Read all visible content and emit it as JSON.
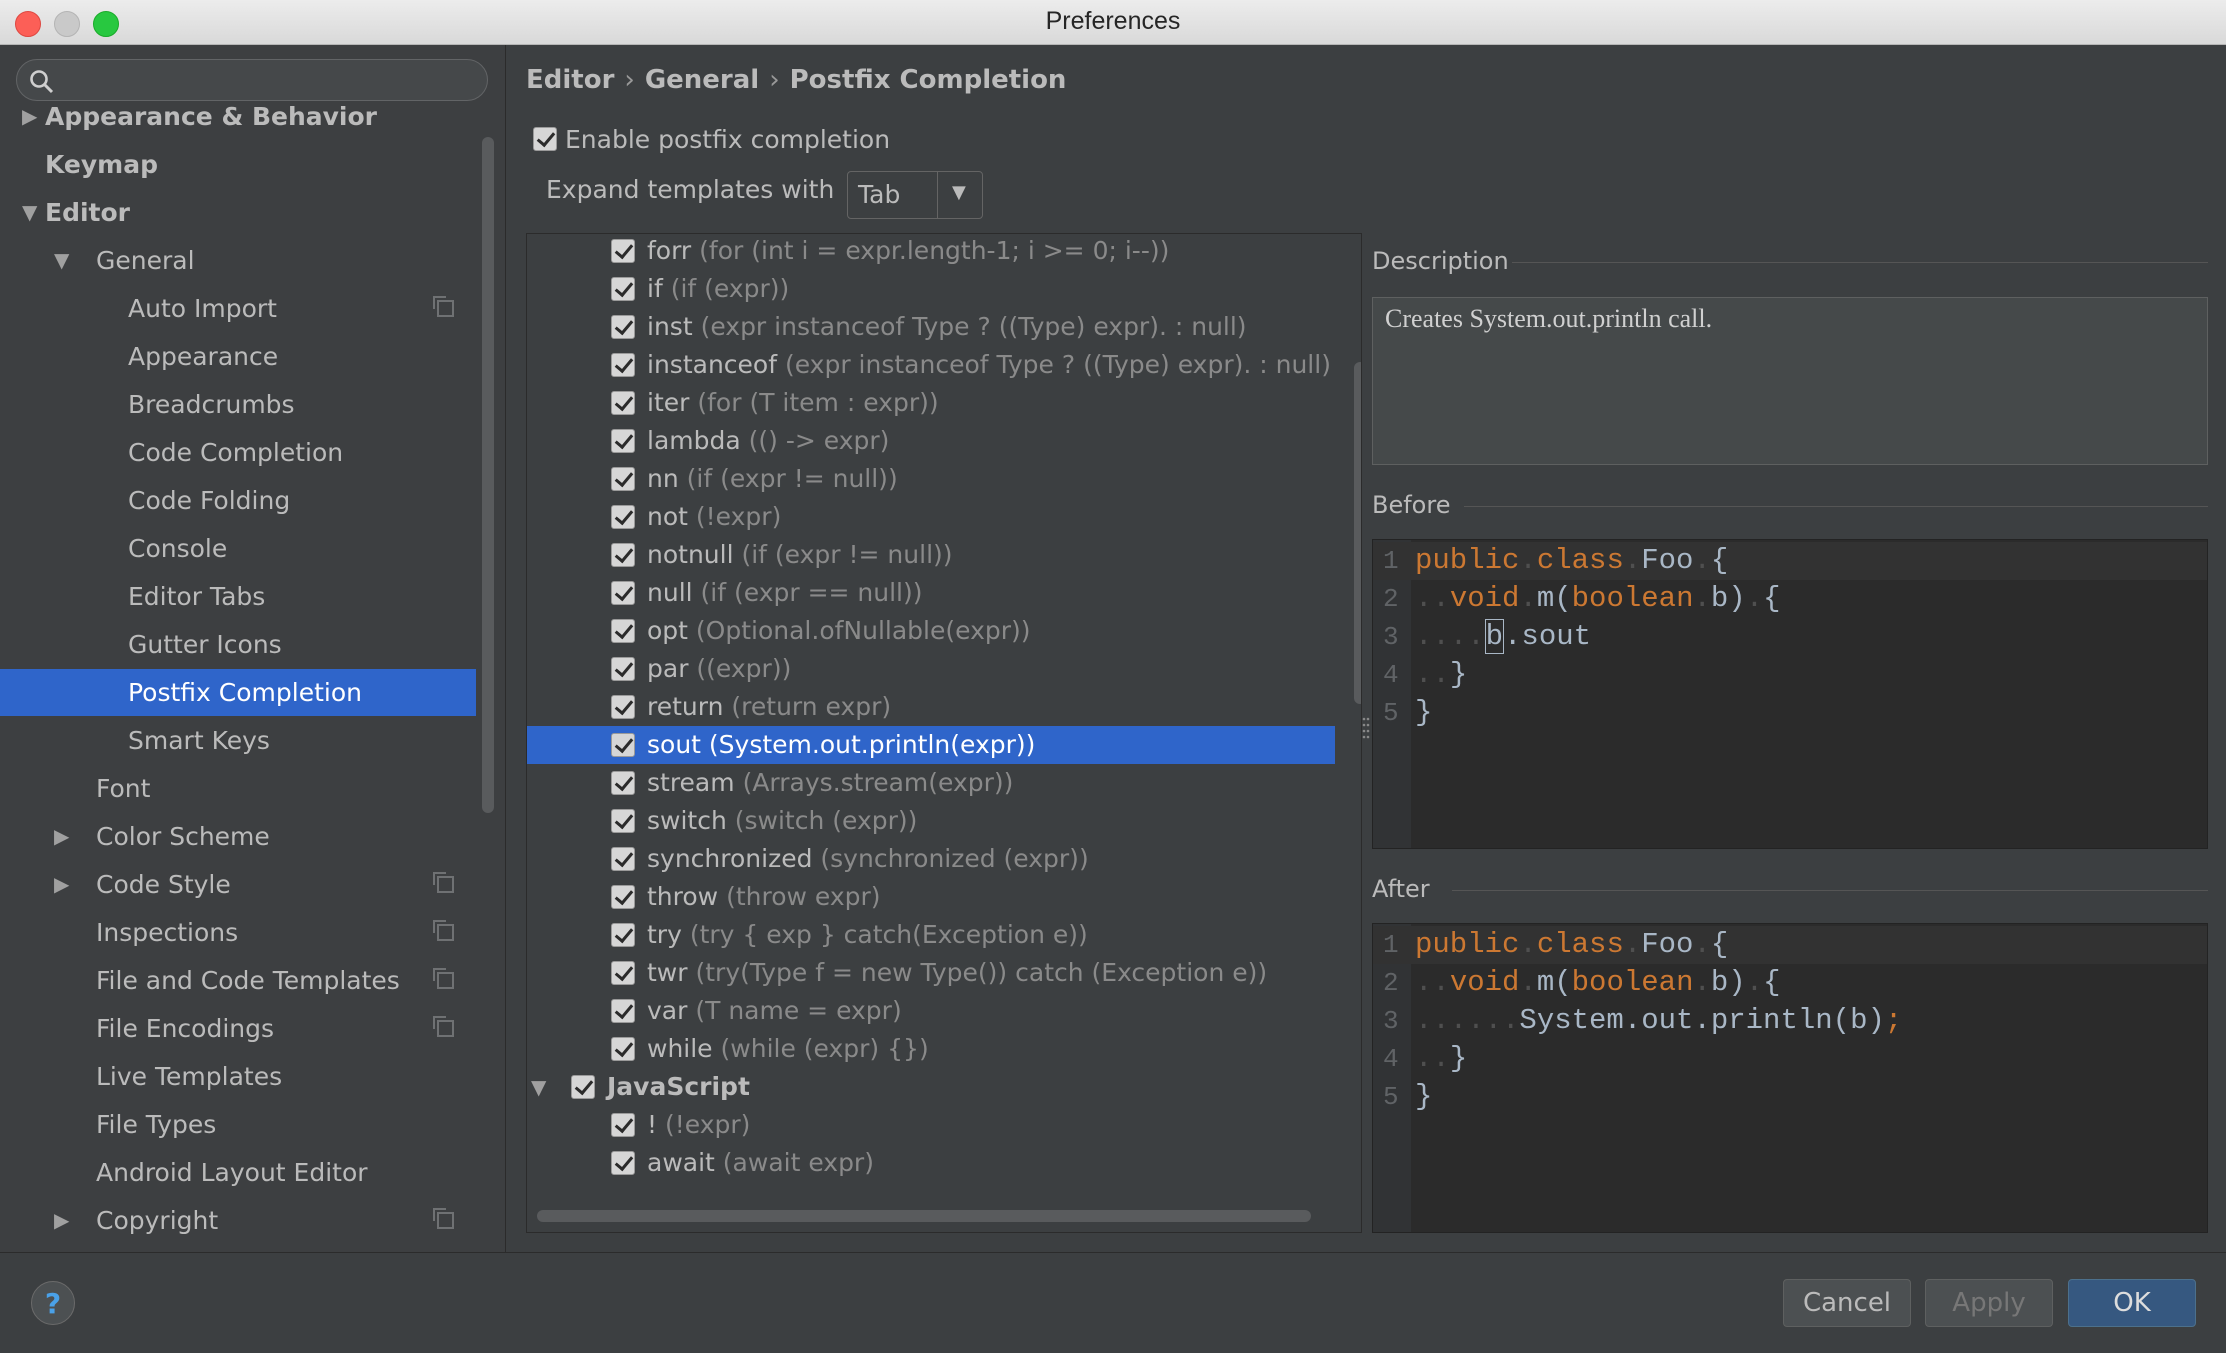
{
  "window": {
    "title": "Preferences"
  },
  "search": {
    "placeholder": "",
    "value": ""
  },
  "sidebar": {
    "items": [
      {
        "label": "Appearance & Behavior",
        "level": 0,
        "arrow": "▶",
        "bold": true,
        "copy": false
      },
      {
        "label": "Keymap",
        "level": 0,
        "arrow": "",
        "bold": true,
        "copy": false
      },
      {
        "label": "Editor",
        "level": 0,
        "arrow": "▼",
        "bold": true,
        "copy": false
      },
      {
        "label": "General",
        "level": 1,
        "arrow": "▼",
        "bold": false,
        "copy": false
      },
      {
        "label": "Auto Import",
        "level": 2,
        "arrow": "",
        "bold": false,
        "copy": true
      },
      {
        "label": "Appearance",
        "level": 2,
        "arrow": "",
        "bold": false,
        "copy": false
      },
      {
        "label": "Breadcrumbs",
        "level": 2,
        "arrow": "",
        "bold": false,
        "copy": false
      },
      {
        "label": "Code Completion",
        "level": 2,
        "arrow": "",
        "bold": false,
        "copy": false
      },
      {
        "label": "Code Folding",
        "level": 2,
        "arrow": "",
        "bold": false,
        "copy": false
      },
      {
        "label": "Console",
        "level": 2,
        "arrow": "",
        "bold": false,
        "copy": false
      },
      {
        "label": "Editor Tabs",
        "level": 2,
        "arrow": "",
        "bold": false,
        "copy": false
      },
      {
        "label": "Gutter Icons",
        "level": 2,
        "arrow": "",
        "bold": false,
        "copy": false
      },
      {
        "label": "Postfix Completion",
        "level": 2,
        "arrow": "",
        "bold": false,
        "copy": false,
        "selected": true
      },
      {
        "label": "Smart Keys",
        "level": 2,
        "arrow": "",
        "bold": false,
        "copy": false
      },
      {
        "label": "Font",
        "level": 1,
        "arrow": "",
        "bold": false,
        "copy": false
      },
      {
        "label": "Color Scheme",
        "level": 1,
        "arrow": "▶",
        "bold": false,
        "copy": false
      },
      {
        "label": "Code Style",
        "level": 1,
        "arrow": "▶",
        "bold": false,
        "copy": true
      },
      {
        "label": "Inspections",
        "level": 1,
        "arrow": "",
        "bold": false,
        "copy": true
      },
      {
        "label": "File and Code Templates",
        "level": 1,
        "arrow": "",
        "bold": false,
        "copy": true
      },
      {
        "label": "File Encodings",
        "level": 1,
        "arrow": "",
        "bold": false,
        "copy": true
      },
      {
        "label": "Live Templates",
        "level": 1,
        "arrow": "",
        "bold": false,
        "copy": false
      },
      {
        "label": "File Types",
        "level": 1,
        "arrow": "",
        "bold": false,
        "copy": false
      },
      {
        "label": "Android Layout Editor",
        "level": 1,
        "arrow": "",
        "bold": false,
        "copy": false
      },
      {
        "label": "Copyright",
        "level": 1,
        "arrow": "▶",
        "bold": false,
        "copy": true
      }
    ]
  },
  "breadcrumb": {
    "parts": [
      "Editor",
      "General",
      "Postfix Completion"
    ],
    "separator": "›"
  },
  "enable": {
    "label": "Enable postfix completion",
    "checked": true
  },
  "expand": {
    "label": "Expand templates with",
    "value": "Tab"
  },
  "templates": [
    {
      "key": "forr",
      "desc": "(for (int i = expr.length-1; i >= 0; i--))",
      "checked": true
    },
    {
      "key": "if",
      "desc": "(if (expr))",
      "checked": true
    },
    {
      "key": "inst",
      "desc": "(expr instanceof Type ? ((Type) expr). : null)",
      "checked": true
    },
    {
      "key": "instanceof",
      "desc": "(expr instanceof Type ? ((Type) expr). : null)",
      "checked": true
    },
    {
      "key": "iter",
      "desc": "(for (T item : expr))",
      "checked": true
    },
    {
      "key": "lambda",
      "desc": "(() -> expr)",
      "checked": true
    },
    {
      "key": "nn",
      "desc": "(if (expr != null))",
      "checked": true
    },
    {
      "key": "not",
      "desc": "(!expr)",
      "checked": true
    },
    {
      "key": "notnull",
      "desc": "(if (expr != null))",
      "checked": true
    },
    {
      "key": "null",
      "desc": "(if (expr == null))",
      "checked": true
    },
    {
      "key": "opt",
      "desc": "(Optional.ofNullable(expr))",
      "checked": true
    },
    {
      "key": "par",
      "desc": "((expr))",
      "checked": true
    },
    {
      "key": "return",
      "desc": "(return expr)",
      "checked": true
    },
    {
      "key": "sout",
      "desc": "(System.out.println(expr))",
      "checked": true,
      "selected": true
    },
    {
      "key": "stream",
      "desc": "(Arrays.stream(expr))",
      "checked": true
    },
    {
      "key": "switch",
      "desc": "(switch (expr))",
      "checked": true
    },
    {
      "key": "synchronized",
      "desc": "(synchronized (expr))",
      "checked": true
    },
    {
      "key": "throw",
      "desc": "(throw expr)",
      "checked": true
    },
    {
      "key": "try",
      "desc": "(try { exp } catch(Exception e))",
      "checked": true
    },
    {
      "key": "twr",
      "desc": "(try(Type f = new Type()) catch (Exception e))",
      "checked": true
    },
    {
      "key": "var",
      "desc": "(T name = expr)",
      "checked": true
    },
    {
      "key": "while",
      "desc": "(while (expr) {})",
      "checked": true
    },
    {
      "key": "JavaScript",
      "desc": "",
      "checked": true,
      "group": true
    },
    {
      "key": "!",
      "desc": "(!expr)",
      "checked": true
    },
    {
      "key": "await",
      "desc": "(await expr)",
      "checked": true
    }
  ],
  "description": {
    "title": "Description",
    "text": "Creates System.out.println call."
  },
  "before": {
    "title": "Before",
    "lines": [
      [
        {
          "t": "public",
          "c": "kw"
        },
        {
          "t": ".",
          "c": "dot"
        },
        {
          "t": "class",
          "c": "kw"
        },
        {
          "t": ".",
          "c": "dot"
        },
        {
          "t": "Foo",
          "c": ""
        },
        {
          "t": ".",
          "c": "dot"
        },
        {
          "t": "{",
          "c": ""
        }
      ],
      [
        {
          "t": "..",
          "c": "dot"
        },
        {
          "t": "void",
          "c": "kw"
        },
        {
          "t": ".",
          "c": "dot"
        },
        {
          "t": "m(",
          "c": ""
        },
        {
          "t": "boolean",
          "c": "kw"
        },
        {
          "t": ".",
          "c": "dot"
        },
        {
          "t": "b)",
          "c": ""
        },
        {
          "t": ".",
          "c": "dot"
        },
        {
          "t": "{",
          "c": ""
        }
      ],
      [
        {
          "t": "....",
          "c": "dot"
        },
        {
          "t": "b",
          "c": "caret"
        },
        {
          "t": ".sout",
          "c": ""
        }
      ],
      [
        {
          "t": "..",
          "c": "dot"
        },
        {
          "t": "}",
          "c": ""
        }
      ],
      [
        {
          "t": "}",
          "c": ""
        }
      ]
    ]
  },
  "after": {
    "title": "After",
    "lines": [
      [
        {
          "t": "public",
          "c": "kw"
        },
        {
          "t": ".",
          "c": "dot"
        },
        {
          "t": "class",
          "c": "kw"
        },
        {
          "t": ".",
          "c": "dot"
        },
        {
          "t": "Foo",
          "c": ""
        },
        {
          "t": ".",
          "c": "dot"
        },
        {
          "t": "{",
          "c": ""
        }
      ],
      [
        {
          "t": "..",
          "c": "dot"
        },
        {
          "t": "void",
          "c": "kw"
        },
        {
          "t": ".",
          "c": "dot"
        },
        {
          "t": "m(",
          "c": ""
        },
        {
          "t": "boolean",
          "c": "kw"
        },
        {
          "t": ".",
          "c": "dot"
        },
        {
          "t": "b)",
          "c": ""
        },
        {
          "t": ".",
          "c": "dot"
        },
        {
          "t": "{",
          "c": ""
        }
      ],
      [
        {
          "t": "......",
          "c": "dot"
        },
        {
          "t": "System.out.println(b)",
          "c": ""
        },
        {
          "t": ";",
          "c": "kw"
        }
      ],
      [
        {
          "t": "..",
          "c": "dot"
        },
        {
          "t": "}",
          "c": ""
        }
      ],
      [
        {
          "t": "}",
          "c": ""
        }
      ]
    ]
  },
  "footer": {
    "help": "?",
    "cancel": "Cancel",
    "apply": "Apply",
    "ok": "OK"
  }
}
